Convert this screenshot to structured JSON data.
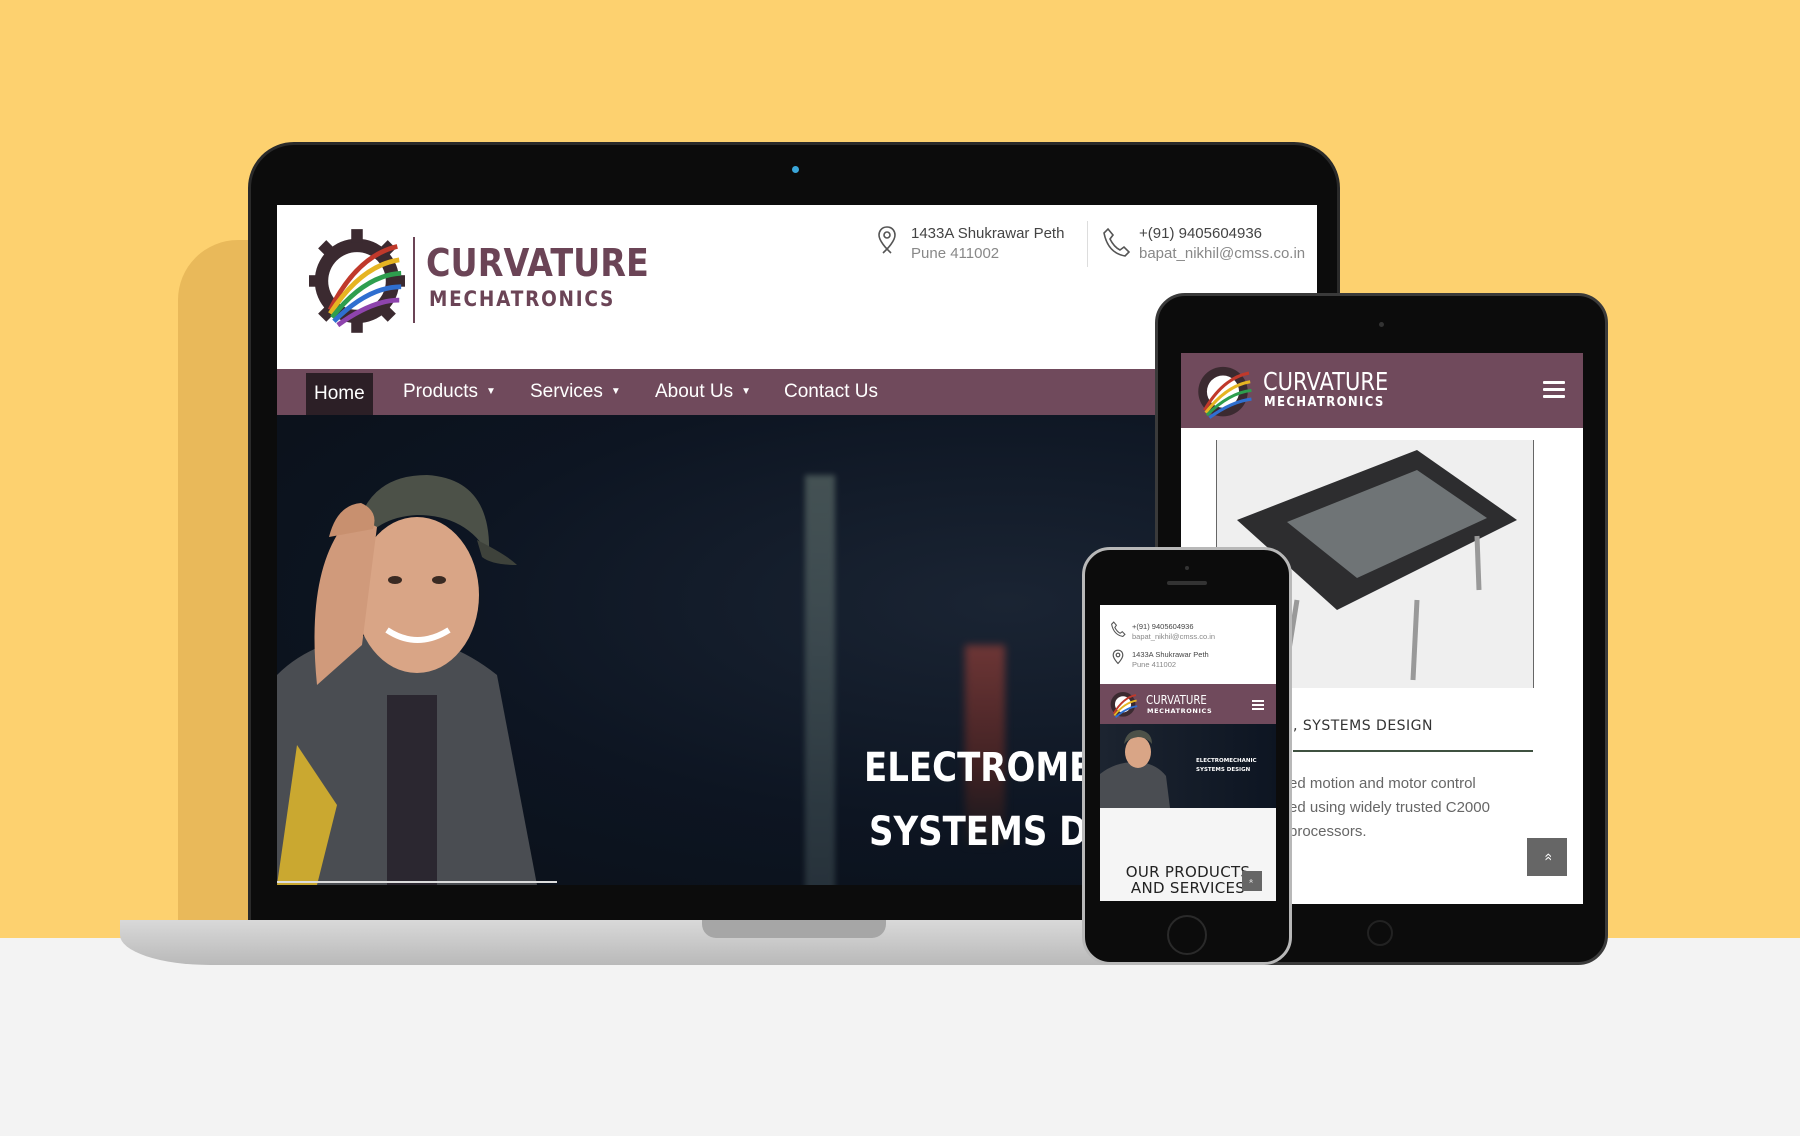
{
  "laptop_site": {
    "logo_line1": "CURVATURE",
    "logo_line2": "MECHATRONICS",
    "address_line1": "1433A Shukrawar Peth",
    "address_line2": "Pune 411002",
    "phone": "+(91) 9405604936",
    "email": "bapat_nikhil@cmss.co.in",
    "nav": [
      {
        "label": "Home",
        "active": true
      },
      {
        "label": "Products",
        "caret": "▼"
      },
      {
        "label": "Services",
        "caret": "▼"
      },
      {
        "label": "About Us",
        "caret": "▼"
      },
      {
        "label": "Contact Us"
      }
    ],
    "hero_line1": "ELECTROMEC",
    "hero_line2": "SYSTEMS DES"
  },
  "tablet_site": {
    "logo_line1": "CURVATURE",
    "logo_line2": "MECHATRONICS",
    "card_title": ", SYSTEMS DESIGN",
    "card_desc_line1": "ed motion and motor control",
    "card_desc_line2": "ed using widely trusted C2000",
    "card_desc_line3": "processors.",
    "back_to_top": "»"
  },
  "phone_site": {
    "phone": "+(91) 9405604936",
    "email": "bapat_nikhil@cmss.co.in",
    "address_line1": "1433A Shukrawar Peth",
    "address_line2": "Pune 411002",
    "logo_line1": "CURVATURE",
    "logo_line2": "MECHATRONICS",
    "hero_line1": "ELECTROMECHANIC",
    "hero_line2": "SYSTEMS DESIGN",
    "section_title_line1": "OUR PRODUCTS",
    "section_title_line2": "AND SERVICES",
    "back_to_top": "»"
  },
  "colors": {
    "background_yellow": "#fdd16f",
    "brand_plum": "#704a5c",
    "floor": "#f3f3f3"
  },
  "icons": [
    "gear-logo-icon",
    "map-pin-icon",
    "phone-icon",
    "hamburger-menu-icon",
    "chevron-up-icon"
  ]
}
